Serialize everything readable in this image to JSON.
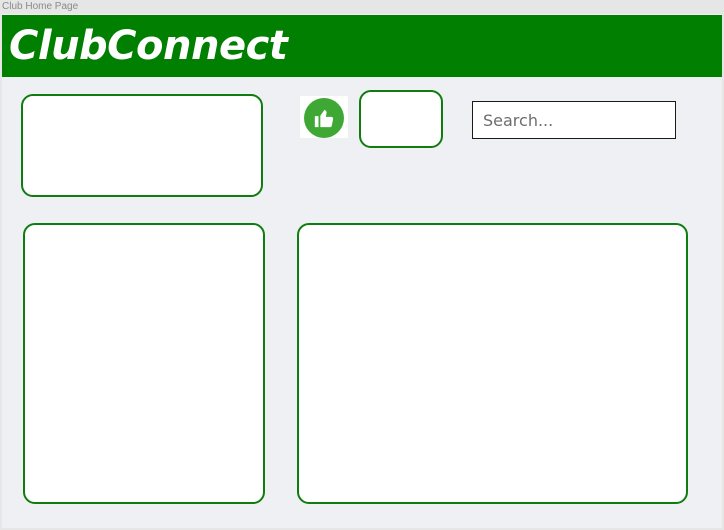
{
  "window": {
    "title": "Club Home Page"
  },
  "header": {
    "brand": "ClubConnect"
  },
  "search": {
    "placeholder": "Search...",
    "value": ""
  },
  "icons": {
    "like": "thumbs-up-icon"
  },
  "colors": {
    "header_bg": "#007f00",
    "panel_border": "#0f7c0f",
    "like_icon_bg": "#3fa835",
    "canvas_bg": "#eff0f4"
  }
}
